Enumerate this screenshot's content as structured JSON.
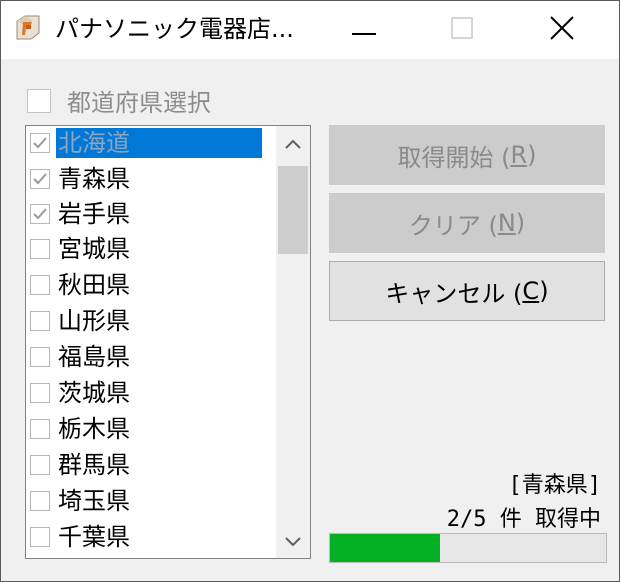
{
  "window": {
    "title": "パナソニック電器店...",
    "icon": "app-logo-icon"
  },
  "controls": {
    "minimize_icon": "minimize-icon",
    "maximize_icon": "maximize-icon",
    "close_icon": "close-icon"
  },
  "prefecture_select": {
    "label": "都道府県選択",
    "checked": false
  },
  "prefecture_list": {
    "items": [
      {
        "label": "北海道",
        "checked": true,
        "selected": true
      },
      {
        "label": "青森県",
        "checked": true,
        "selected": false
      },
      {
        "label": "岩手県",
        "checked": true,
        "selected": false
      },
      {
        "label": "宮城県",
        "checked": false,
        "selected": false
      },
      {
        "label": "秋田県",
        "checked": false,
        "selected": false
      },
      {
        "label": "山形県",
        "checked": false,
        "selected": false
      },
      {
        "label": "福島県",
        "checked": false,
        "selected": false
      },
      {
        "label": "茨城県",
        "checked": false,
        "selected": false
      },
      {
        "label": "栃木県",
        "checked": false,
        "selected": false
      },
      {
        "label": "群馬県",
        "checked": false,
        "selected": false
      },
      {
        "label": "埼玉県",
        "checked": false,
        "selected": false
      },
      {
        "label": "千葉県",
        "checked": false,
        "selected": false
      }
    ]
  },
  "buttons": {
    "start": {
      "label": "取得開始 (",
      "key": "R",
      "close": ")",
      "enabled": false
    },
    "clear": {
      "label": "クリア (",
      "key": "N",
      "close": ")",
      "enabled": false
    },
    "cancel": {
      "label": "キャンセル (",
      "key": "C",
      "close": ")",
      "enabled": true
    }
  },
  "status": {
    "current_prefecture": "[青森県]",
    "count_text": "2/5 件 取得中",
    "progress_fraction": 0.4
  },
  "colors": {
    "selection": "#0078d7",
    "progress": "#06b025"
  }
}
